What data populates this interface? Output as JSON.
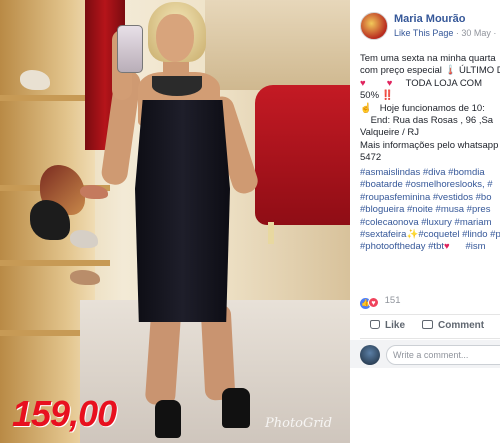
{
  "photo": {
    "price_overlay": "159,00",
    "watermark": "PhotoGrid"
  },
  "post": {
    "page_name": "Maria Mourão",
    "like_page": "Like This Page",
    "date": "30 May",
    "text_lines": [
      "Tem uma sexta na minha quarta",
      "com preço especial 🌡️ ÚLTIMO D",
      "TODA LOJA COM",
      "50% ‼️",
      "Hoje funcionamos de 10:",
      "End: Rua das Rosas , 96 ,Sa",
      "Valqueire / RJ",
      "Mais informações pelo whatsapp",
      "5472"
    ],
    "hashtag_lines": [
      "#asmaislindas #diva #bomdia",
      "#boatarde #osmelhoreslooks, #",
      "#roupasfeminina #vestidos #bo",
      "#blogueira #noite #musa #pres",
      "#colecaonova #luxury #mariam",
      "#sextafeira",
      "#coquetel",
      "#lindo #p",
      "#photooftheday #tbt",
      "#ism"
    ],
    "reaction_count": "151",
    "like_label": "Like",
    "comment_label": "Comment",
    "comment_placeholder": "Write a comment..."
  },
  "icons": {
    "globe": "globe-icon",
    "like": "thumbs-up-icon",
    "comment": "speech-bubble-icon",
    "heart": "heart-icon",
    "pointing": "pointing-finger-icon"
  },
  "colors": {
    "fb_link": "#365899",
    "price_red": "#e8101f",
    "like_blue": "#4d7ef7",
    "love_red": "#f0435c"
  }
}
